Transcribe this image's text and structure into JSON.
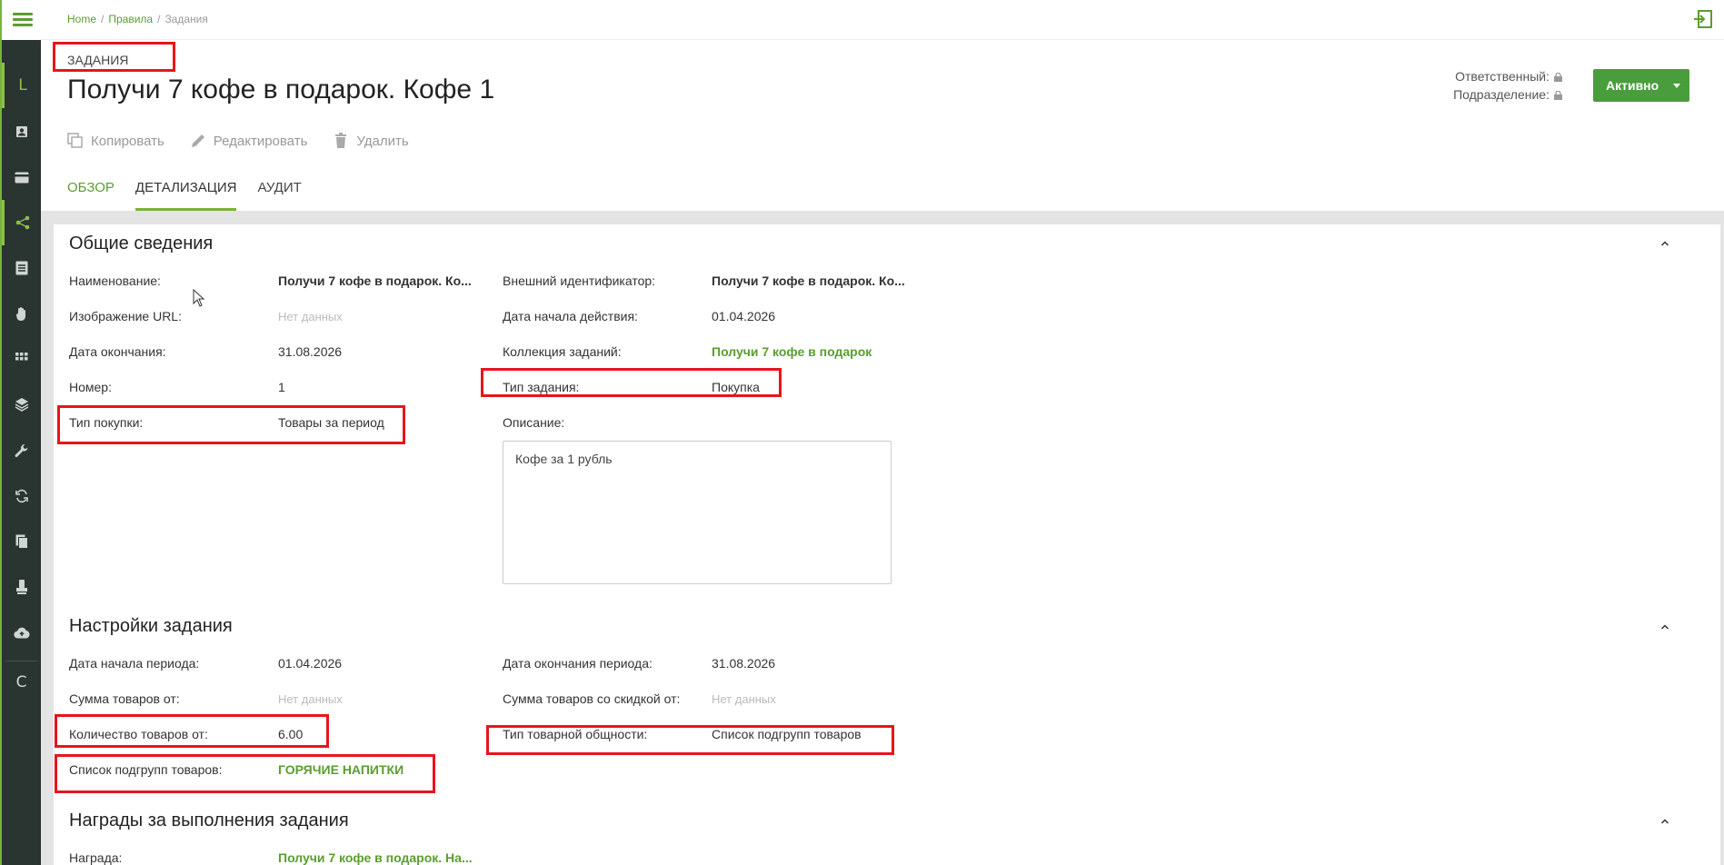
{
  "breadcrumb": {
    "home": "Home",
    "rules": "Правила",
    "current": "Задания"
  },
  "header": {
    "section_tag": "ЗАДАНИЯ",
    "title": "Получи 7 кофе в подарок. Кофе 1",
    "responsible_label": "Ответственный:",
    "department_label": "Подразделение:",
    "status": "Активно"
  },
  "actions": {
    "copy": "Копировать",
    "edit": "Редактировать",
    "delete": "Удалить"
  },
  "tabs": [
    {
      "label": "ОБЗОР"
    },
    {
      "label": "ДЕТАЛИЗАЦИЯ"
    },
    {
      "label": "АУДИТ"
    }
  ],
  "sidebar": {
    "top_letter": "L",
    "bottom_letter": "C",
    "icons": [
      "user-icon",
      "card-icon",
      "share-icon",
      "list-icon",
      "hand-icon",
      "grid-icon",
      "layers-icon",
      "wrench-icon",
      "sync-icon",
      "files-icon",
      "stamp-icon",
      "cloud-upload-icon"
    ]
  },
  "general": {
    "title": "Общие сведения",
    "name_label": "Наименование:",
    "name_value": "Получи 7 кофе в подарок. Ко...",
    "ext_id_label": "Внешний идентификатор:",
    "ext_id_value": "Получи 7 кофе в подарок. Ко...",
    "image_url_label": "Изображение URL:",
    "image_url_value": "Нет данных",
    "start_date_label": "Дата начала действия:",
    "start_date_value": "01.04.2026",
    "end_date_label": "Дата окончания:",
    "end_date_value": "31.08.2026",
    "collection_label": "Коллекция заданий:",
    "collection_value": "Получи 7 кофе в подарок",
    "number_label": "Номер:",
    "number_value": "1",
    "task_type_label": "Тип задания:",
    "task_type_value": "Покупка",
    "purchase_type_label": "Тип покупки:",
    "purchase_type_value": "Товары за период",
    "description_label": "Описание:",
    "description_value": "Кофе за 1 рубль"
  },
  "settings": {
    "title": "Настройки задания",
    "period_start_label": "Дата начала периода:",
    "period_start_value": "01.04.2026",
    "period_end_label": "Дата окончания периода:",
    "period_end_value": "31.08.2026",
    "sum_from_label": "Сумма товаров от:",
    "sum_from_value": "Нет данных",
    "sum_discount_label": "Сумма товаров со скидкой от:",
    "sum_discount_value": "Нет данных",
    "qty_from_label": "Количество товаров от:",
    "qty_from_value": "6.00",
    "commonality_label": "Тип товарной общности:",
    "commonality_value": "Список подгрупп товаров",
    "subgroups_label": "Список подгрупп товаров:",
    "subgroups_value": "ГОРЯЧИЕ НАПИТКИ"
  },
  "rewards": {
    "title": "Награды за выполнения задания",
    "reward_label": "Награда:",
    "reward_value": "Получи 7 кофе в подарок. На..."
  },
  "colors": {
    "accent": "#5a9e2f",
    "status_bg": "#4a9d3c",
    "highlight": "#e8141c",
    "sidebar": "#2a3430"
  }
}
